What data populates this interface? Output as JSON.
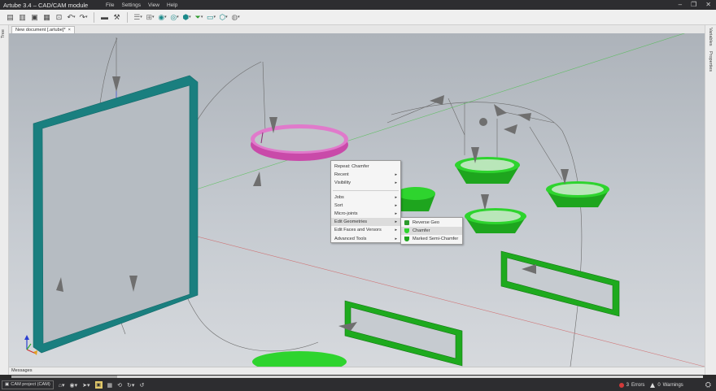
{
  "app": {
    "title": "Artube 3.4 – CAD/CAM module"
  },
  "menu": [
    "File",
    "Settings",
    "View",
    "Help"
  ],
  "window_controls": {
    "minimize": "–",
    "maximize": "❐",
    "close": "✕"
  },
  "left_panel": {
    "label": "Tree"
  },
  "right_panel": {
    "labels": [
      "Variables",
      "Properties"
    ]
  },
  "document_tab": {
    "label": "New document [.artube]*",
    "close": "×"
  },
  "context_menu": {
    "items": [
      {
        "label": "Repeat: Chamfer",
        "submenu": false
      },
      {
        "label": "Recent",
        "submenu": true
      },
      {
        "label": "Visibility",
        "submenu": true
      },
      {
        "label": "Jobs",
        "submenu": true
      },
      {
        "label": "Sort",
        "submenu": true
      },
      {
        "label": "Micro-joints",
        "submenu": true
      },
      {
        "label": "Edit Geometries",
        "submenu": true,
        "highlighted": true
      },
      {
        "label": "Edit Faces and Versors",
        "submenu": true
      },
      {
        "label": "Advanced Tools",
        "submenu": true
      }
    ]
  },
  "submenu": {
    "items": [
      {
        "label": "Reverse Geo",
        "icon": "reverse-geo-icon"
      },
      {
        "label": "Chamfer",
        "icon": "chamfer-icon",
        "highlighted": true
      },
      {
        "label": "Marked Semi-Chamfer",
        "icon": "semi-chamfer-icon"
      }
    ]
  },
  "messages": {
    "label": "Messages"
  },
  "status": {
    "project_tab": "CAM project (CAM)",
    "errors_count": "3",
    "errors_label": "Errors",
    "warnings_count": "0",
    "warnings_label": "Warnings"
  },
  "colors": {
    "frame": "#1e8e8e",
    "ring": "#d05cb4",
    "cups": "#22c022",
    "viewport_top": "#adb3ba",
    "viewport_bottom": "#d6d9dd"
  }
}
